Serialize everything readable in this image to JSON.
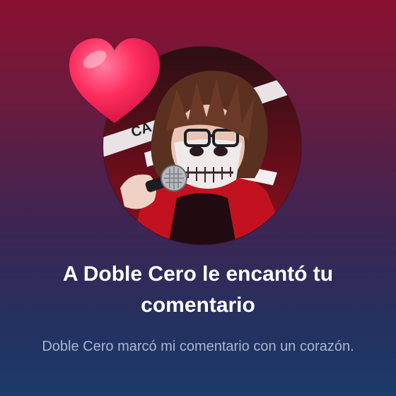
{
  "notification": {
    "title": "A Doble Cero le encantó tu comentario",
    "message": "Doble Cero marcó mi comentario con un corazón.",
    "avatar_tape_text": "CA"
  },
  "icons": {
    "reaction": "heart-icon"
  },
  "colors": {
    "background_top": "#8a1030",
    "background_bottom": "#1c3a6a",
    "heart": "#ff2d5f",
    "title_text": "#ffffff",
    "message_text": "#aab4d2"
  }
}
